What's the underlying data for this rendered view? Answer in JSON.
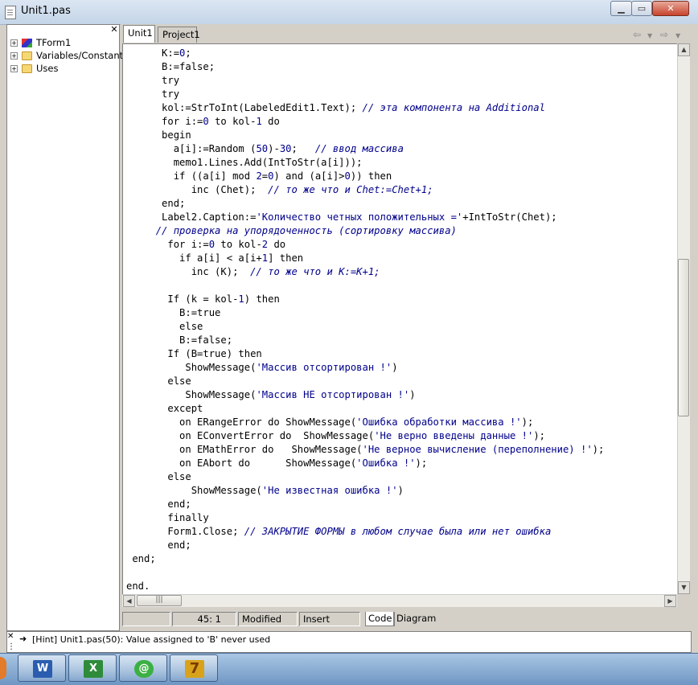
{
  "window": {
    "title": "Unit1.pas"
  },
  "explorer": {
    "items": [
      {
        "label": "TForm1",
        "icon": "form-icon"
      },
      {
        "label": "Variables/Constants",
        "icon": "folder-icon"
      },
      {
        "label": "Uses",
        "icon": "folder-icon"
      }
    ]
  },
  "tabs": [
    {
      "label": "Unit1"
    },
    {
      "label": "Project1"
    }
  ],
  "code_lines": [
    "      K:=0;",
    "      B:=false;",
    "      try",
    "      try",
    "      kol:=StrToInt(LabeledEdit1.Text); // эта компонента на Additional",
    "      for i:=0 to kol-1 do",
    "      begin",
    "        a[i]:=Random (50)-30;   // ввод массива",
    "        memo1.Lines.Add(IntToStr(a[i]));",
    "        if ((a[i] mod 2=0) and (a[i]>0)) then",
    "           inc (Chet);  // то же что и Chet:=Chet+1;",
    "      end;",
    "      Label2.Caption:='Количество четных положительных ='+IntToStr(Chet);",
    "     // проверка на упорядоченность (сортировку массива)",
    "       for i:=0 to kol-2 do",
    "         if a[i] < a[i+1] then",
    "           inc (K);  // то же что и K:=K+1;",
    "",
    "       If (k = kol-1) then",
    "         B:=true",
    "         else",
    "         B:=false;",
    "       If (B=true) then",
    "          ShowMessage('Массив отсортирован !')",
    "       else",
    "          ShowMessage('Массив НЕ отсортирован !')",
    "       except",
    "         on ERangeError do ShowMessage('Ошибка обработки массива !');",
    "         on EConvertError do  ShowMessage('Не верно введены данные !');",
    "         on EMathError do   ShowMessage('Не верное вычисление (переполнение) !');",
    "         on EAbort do      ShowMessage('Ошибка !');",
    "       else",
    "           ShowMessage('Не известная ошибка !')",
    "       end;",
    "       finally",
    "       Form1.Close; // ЗАКРЫТИЕ ФОРМЫ в любом случае была или нет ошибка",
    "       end;",
    " end;",
    "",
    "end."
  ],
  "status": {
    "position": "45:  1",
    "modified": "Modified",
    "mode": "Insert",
    "code_tab": "Code",
    "diagram_tab": "Diagram"
  },
  "messages": {
    "hint": "[Hint] Unit1.pas(50): Value assigned to 'B' never used"
  },
  "taskbar": [
    {
      "name": "word-icon",
      "glyph": "W"
    },
    {
      "name": "excel-icon",
      "glyph": "X"
    },
    {
      "name": "mail-agent-icon",
      "glyph": "@"
    },
    {
      "name": "delphi-icon",
      "glyph": "7"
    }
  ]
}
